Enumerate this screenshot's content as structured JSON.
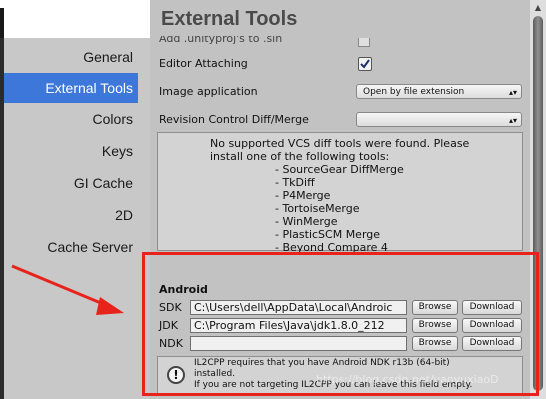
{
  "sidebar": {
    "items": [
      {
        "label": "General",
        "selected": false
      },
      {
        "label": "External Tools",
        "selected": true
      },
      {
        "label": "Colors",
        "selected": false
      },
      {
        "label": "Keys",
        "selected": false
      },
      {
        "label": "GI Cache",
        "selected": false
      },
      {
        "label": "2D",
        "selected": false
      },
      {
        "label": "Cache Server",
        "selected": false
      }
    ]
  },
  "main": {
    "title": "External Tools",
    "cutoff_label": "Add .unityproj's to .sln",
    "editor_attaching": {
      "label": "Editor Attaching",
      "checked": true
    },
    "image_application": {
      "label": "Image application",
      "value": "Open by file extension"
    },
    "revision_control": {
      "label": "Revision Control Diff/Merge",
      "value": ""
    },
    "vcs_message": "No supported VCS diff tools were found. Please\ninstall one of the following tools:",
    "vcs_tools": [
      "- SourceGear DiffMerge",
      "- TkDiff",
      "- P4Merge",
      "- TortoiseMerge",
      "- WinMerge",
      "- PlasticSCM Merge",
      "- Beyond Compare 4"
    ]
  },
  "android": {
    "header": "Android",
    "rows": [
      {
        "label": "SDK",
        "value": "C:\\Users\\dell\\AppData\\Local\\Androic",
        "browse": "Browse",
        "download": "Download"
      },
      {
        "label": "JDK",
        "value": "C:\\Program Files\\Java\\jdk1.8.0_212",
        "browse": "Browse",
        "download": "Download"
      },
      {
        "label": "NDK",
        "value": "",
        "browse": "Browse",
        "download": "Download"
      }
    ],
    "warning_icon": "!",
    "warning": "IL2CPP requires that you have Android NDK r13b (64-bit)\ninstalled.\nIf you are not targeting IL2CPP you can leave this field empty."
  },
  "annotation": {
    "color": "#e7231b"
  },
  "watermark": "https://blog.csdn.net/yaoyuxiaoD",
  "colors": {
    "accent": "#3c77d9",
    "highlight": "#e7231b"
  }
}
